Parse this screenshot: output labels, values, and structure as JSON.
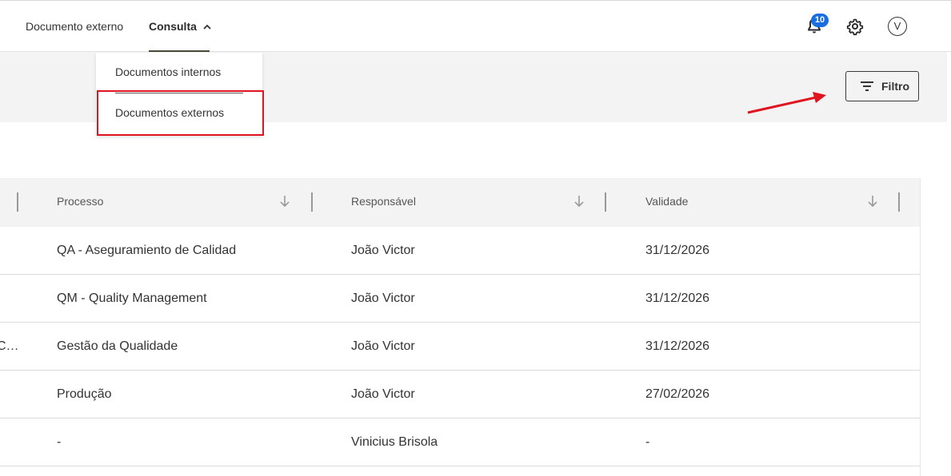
{
  "nav": {
    "doc_externo": "Documento externo",
    "consulta": "Consulta",
    "consulta_chevron": "^",
    "notifications_count": "10",
    "avatar_initial": "V"
  },
  "icons": {
    "bell": "bell-icon",
    "gear": "gear-icon",
    "filter": "filter-lines-icon",
    "sort": "arrow-down-icon",
    "chevron": "chevron-up-icon"
  },
  "dropdown": {
    "items": [
      "Documentos internos",
      "Documentos externos"
    ]
  },
  "filter": {
    "label": "Filtro"
  },
  "table": {
    "columns": [
      "Processo",
      "Responsável",
      "Validade"
    ],
    "rows": [
      {
        "first": "",
        "processo": "QA - Aseguramiento de Calidad",
        "responsavel": "João Victor",
        "validade": "31/12/2026"
      },
      {
        "first": "",
        "processo": "QM - Quality Management",
        "responsavel": "João Victor",
        "validade": "31/12/2026"
      },
      {
        "first": "C…",
        "processo": "Gestão da Qualidade",
        "responsavel": "João Victor",
        "validade": "31/12/2026"
      },
      {
        "first": "",
        "processo": "Produção",
        "responsavel": "João Victor",
        "validade": "27/02/2026"
      },
      {
        "first": "",
        "processo": "-",
        "responsavel": "Vinicius Brisola",
        "validade": "-"
      }
    ]
  },
  "colors": {
    "accent_badge": "#1a6de0",
    "highlight_red": "#e0141e",
    "band_gray": "#f3f3f3"
  }
}
